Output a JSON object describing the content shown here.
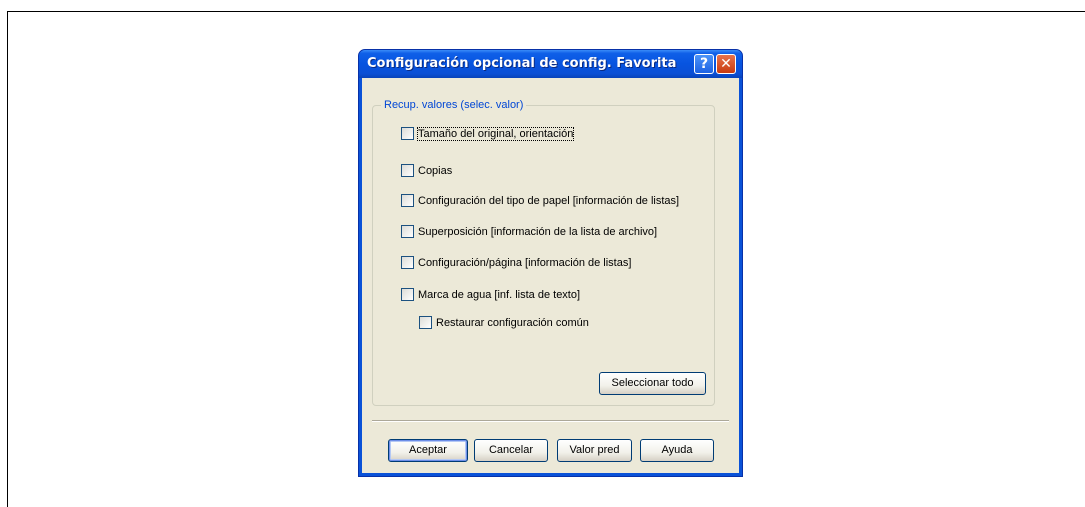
{
  "window": {
    "title": "Configuración opcional de config. Favorita",
    "help_button": "?",
    "close_button": "✕"
  },
  "group": {
    "legend": "Recup. valores (selec. valor)"
  },
  "options": [
    {
      "label": "Tamaño del original, orientación",
      "checked": false
    },
    {
      "label": "Copias",
      "checked": false
    },
    {
      "label": "Configuración del tipo de papel [información de listas]",
      "checked": false
    },
    {
      "label": "Superposición [información de la lista de archivo]",
      "checked": false
    },
    {
      "label": "Configuración/página [información de listas]",
      "checked": false
    },
    {
      "label": "Marca de agua [inf. lista de texto]",
      "checked": false
    },
    {
      "label": "Restaurar configuración común",
      "checked": false
    }
  ],
  "select_all_label": "Seleccionar todo",
  "buttons": {
    "ok": "Aceptar",
    "cancel": "Cancelar",
    "default": "Valor pred",
    "help": "Ayuda"
  }
}
